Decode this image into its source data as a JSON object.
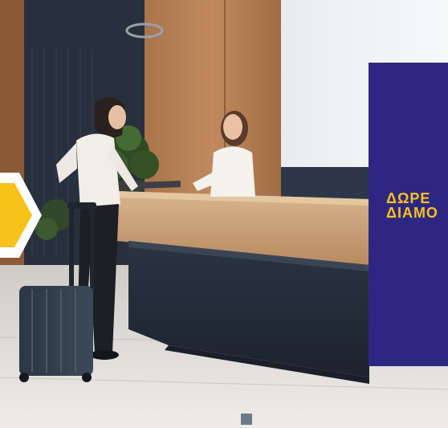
{
  "promo": {
    "line1": "ΔΩΡΕ",
    "line2": "ΔΙΑΜΟ"
  },
  "colors": {
    "panel": "#2e2782",
    "accent_yellow": "#f7c21b",
    "wood": "#b9865c",
    "floor": "#d9d6d0"
  },
  "icons": {
    "arrow": "chevron-right-icon"
  }
}
